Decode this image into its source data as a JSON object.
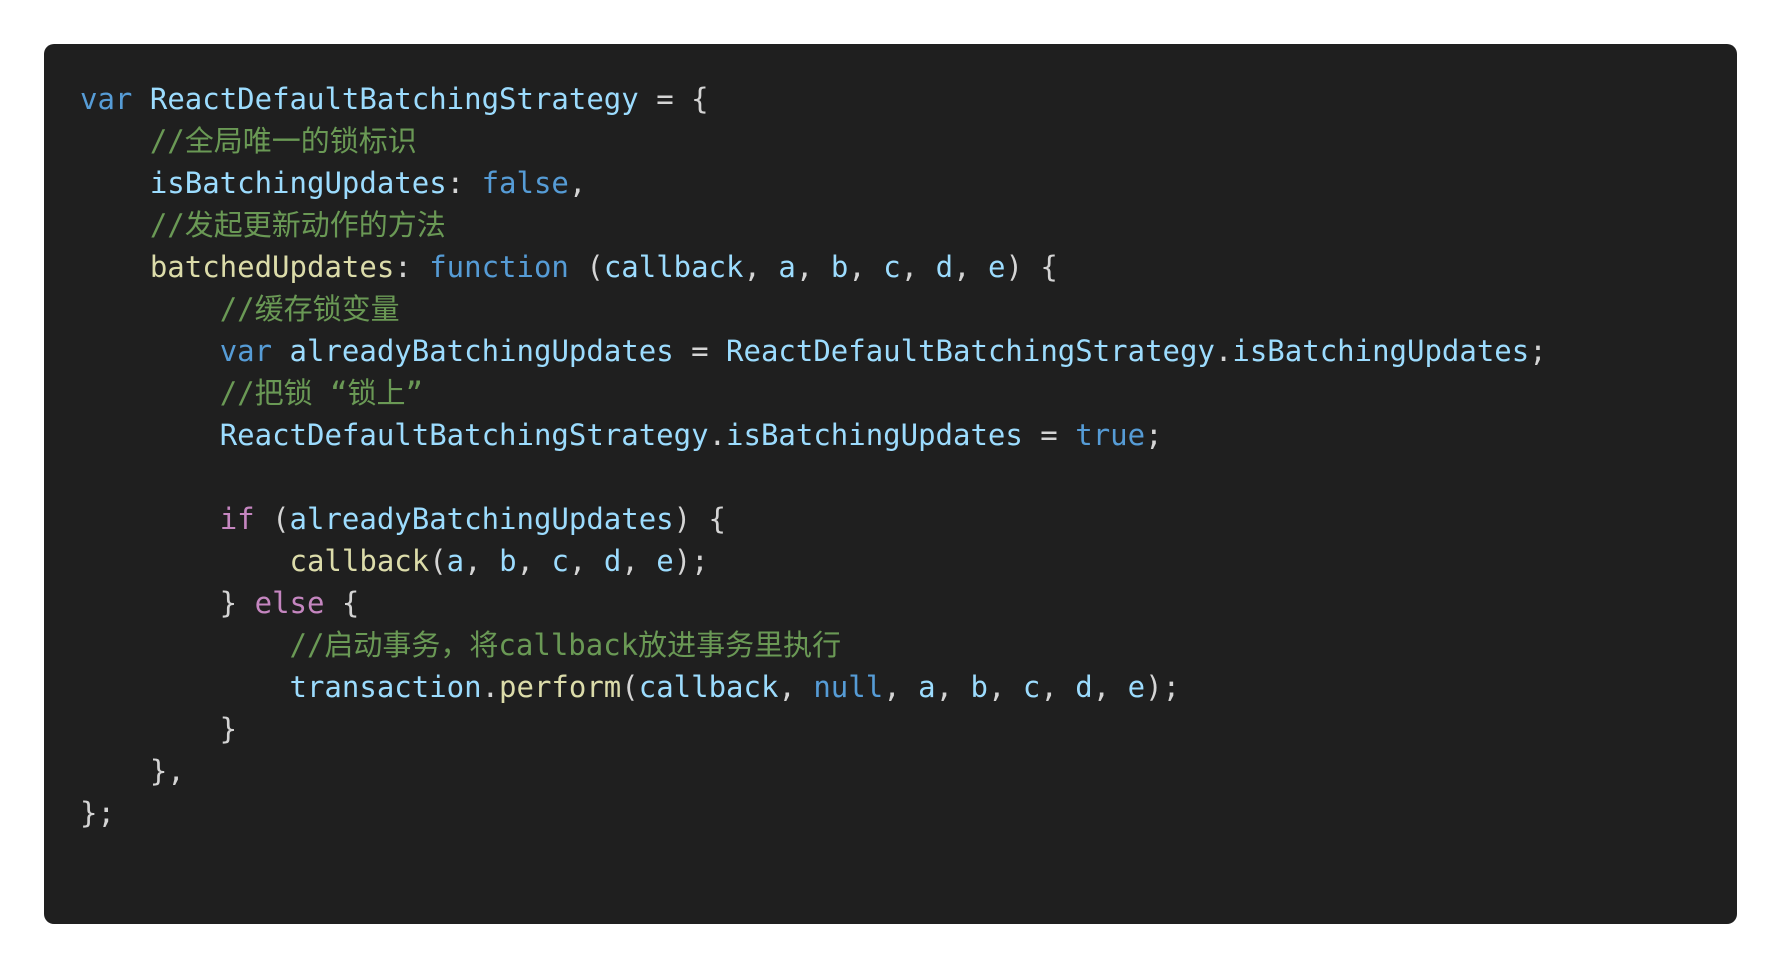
{
  "code": {
    "language": "javascript",
    "lines": [
      {
        "tokens": [
          {
            "t": "var",
            "c": "kw"
          },
          {
            "t": " ",
            "c": "pn"
          },
          {
            "t": "ReactDefaultBatchingStrategy",
            "c": "var"
          },
          {
            "t": " = {",
            "c": "pn"
          }
        ]
      },
      {
        "tokens": [
          {
            "t": "    ",
            "c": "pn"
          },
          {
            "t": "//全局唯一的锁标识",
            "c": "cm"
          }
        ]
      },
      {
        "tokens": [
          {
            "t": "    ",
            "c": "pn"
          },
          {
            "t": "isBatchingUpdates",
            "c": "var"
          },
          {
            "t": ": ",
            "c": "pn"
          },
          {
            "t": "false",
            "c": "kw"
          },
          {
            "t": ",",
            "c": "pn"
          }
        ]
      },
      {
        "tokens": [
          {
            "t": "    ",
            "c": "pn"
          },
          {
            "t": "//发起更新动作的方法",
            "c": "cm"
          }
        ]
      },
      {
        "tokens": [
          {
            "t": "    ",
            "c": "pn"
          },
          {
            "t": "batchedUpdates",
            "c": "fn"
          },
          {
            "t": ": ",
            "c": "pn"
          },
          {
            "t": "function",
            "c": "kw"
          },
          {
            "t": " (",
            "c": "pn"
          },
          {
            "t": "callback",
            "c": "var"
          },
          {
            "t": ", ",
            "c": "pn"
          },
          {
            "t": "a",
            "c": "var"
          },
          {
            "t": ", ",
            "c": "pn"
          },
          {
            "t": "b",
            "c": "var"
          },
          {
            "t": ", ",
            "c": "pn"
          },
          {
            "t": "c",
            "c": "var"
          },
          {
            "t": ", ",
            "c": "pn"
          },
          {
            "t": "d",
            "c": "var"
          },
          {
            "t": ", ",
            "c": "pn"
          },
          {
            "t": "e",
            "c": "var"
          },
          {
            "t": ") {",
            "c": "pn"
          }
        ]
      },
      {
        "tokens": [
          {
            "t": "        ",
            "c": "pn"
          },
          {
            "t": "//缓存锁变量",
            "c": "cm"
          }
        ]
      },
      {
        "tokens": [
          {
            "t": "        ",
            "c": "pn"
          },
          {
            "t": "var",
            "c": "kw"
          },
          {
            "t": " ",
            "c": "pn"
          },
          {
            "t": "alreadyBatchingUpdates",
            "c": "var"
          },
          {
            "t": " = ",
            "c": "pn"
          },
          {
            "t": "ReactDefaultBatchingStrategy",
            "c": "var"
          },
          {
            "t": ".",
            "c": "pn"
          },
          {
            "t": "isBatchingUpdates",
            "c": "var"
          },
          {
            "t": ";",
            "c": "pn"
          }
        ]
      },
      {
        "tokens": [
          {
            "t": "        ",
            "c": "pn"
          },
          {
            "t": "//把锁 “锁上”",
            "c": "cm"
          }
        ]
      },
      {
        "tokens": [
          {
            "t": "        ",
            "c": "pn"
          },
          {
            "t": "ReactDefaultBatchingStrategy",
            "c": "var"
          },
          {
            "t": ".",
            "c": "pn"
          },
          {
            "t": "isBatchingUpdates",
            "c": "var"
          },
          {
            "t": " = ",
            "c": "pn"
          },
          {
            "t": "true",
            "c": "kw"
          },
          {
            "t": ";",
            "c": "pn"
          }
        ]
      },
      {
        "tokens": []
      },
      {
        "tokens": [
          {
            "t": "        ",
            "c": "pn"
          },
          {
            "t": "if",
            "c": "ctrl"
          },
          {
            "t": " (",
            "c": "pn"
          },
          {
            "t": "alreadyBatchingUpdates",
            "c": "var"
          },
          {
            "t": ") {",
            "c": "pn"
          }
        ]
      },
      {
        "tokens": [
          {
            "t": "            ",
            "c": "pn"
          },
          {
            "t": "callback",
            "c": "fn"
          },
          {
            "t": "(",
            "c": "pn"
          },
          {
            "t": "a",
            "c": "var"
          },
          {
            "t": ", ",
            "c": "pn"
          },
          {
            "t": "b",
            "c": "var"
          },
          {
            "t": ", ",
            "c": "pn"
          },
          {
            "t": "c",
            "c": "var"
          },
          {
            "t": ", ",
            "c": "pn"
          },
          {
            "t": "d",
            "c": "var"
          },
          {
            "t": ", ",
            "c": "pn"
          },
          {
            "t": "e",
            "c": "var"
          },
          {
            "t": ");",
            "c": "pn"
          }
        ]
      },
      {
        "tokens": [
          {
            "t": "        } ",
            "c": "pn"
          },
          {
            "t": "else",
            "c": "ctrl"
          },
          {
            "t": " {",
            "c": "pn"
          }
        ]
      },
      {
        "tokens": [
          {
            "t": "            ",
            "c": "pn"
          },
          {
            "t": "//启动事务，将callback放进事务里执行",
            "c": "cm"
          }
        ]
      },
      {
        "tokens": [
          {
            "t": "            ",
            "c": "pn"
          },
          {
            "t": "transaction",
            "c": "var"
          },
          {
            "t": ".",
            "c": "pn"
          },
          {
            "t": "perform",
            "c": "fn"
          },
          {
            "t": "(",
            "c": "pn"
          },
          {
            "t": "callback",
            "c": "var"
          },
          {
            "t": ", ",
            "c": "pn"
          },
          {
            "t": "null",
            "c": "kw"
          },
          {
            "t": ", ",
            "c": "pn"
          },
          {
            "t": "a",
            "c": "var"
          },
          {
            "t": ", ",
            "c": "pn"
          },
          {
            "t": "b",
            "c": "var"
          },
          {
            "t": ", ",
            "c": "pn"
          },
          {
            "t": "c",
            "c": "var"
          },
          {
            "t": ", ",
            "c": "pn"
          },
          {
            "t": "d",
            "c": "var"
          },
          {
            "t": ", ",
            "c": "pn"
          },
          {
            "t": "e",
            "c": "var"
          },
          {
            "t": ");",
            "c": "pn"
          }
        ]
      },
      {
        "tokens": [
          {
            "t": "        }",
            "c": "pn"
          }
        ]
      },
      {
        "tokens": [
          {
            "t": "    },",
            "c": "pn"
          }
        ]
      },
      {
        "tokens": [
          {
            "t": "};",
            "c": "pn"
          }
        ]
      }
    ]
  }
}
